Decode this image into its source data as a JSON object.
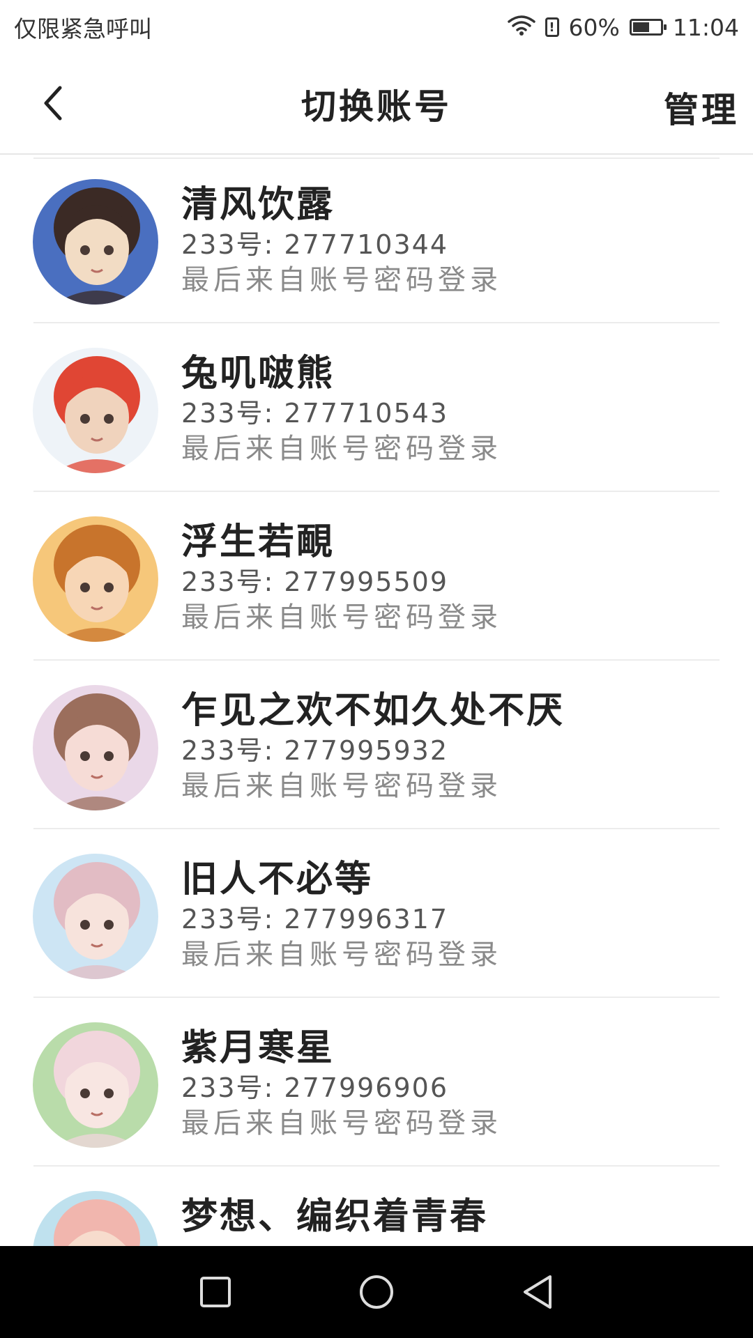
{
  "status_bar": {
    "carrier_text": "仅限紧急呼叫",
    "battery_percent": "60%",
    "battery_level": 0.6,
    "time": "11:04",
    "icons": [
      "wifi-icon",
      "alert-icon",
      "battery-icon"
    ]
  },
  "header": {
    "title": "切换账号",
    "manage_label": "管理",
    "back_icon": "chevron-left-icon"
  },
  "accounts": [
    {
      "nickname": "清风饮露",
      "uid_text": "233号: 277710344",
      "login_source": "最后来自账号密码登录",
      "avatar_palette": [
        "#4a6fc0",
        "#f2dcc4",
        "#3b2a25"
      ]
    },
    {
      "nickname": "兔叽啵熊",
      "uid_text": "233号: 277710543",
      "login_source": "最后来自账号密码登录",
      "avatar_palette": [
        "#eef3f8",
        "#f0d3bd",
        "#e04634"
      ]
    },
    {
      "nickname": "浮生若靦",
      "uid_text": "233号: 277995509",
      "login_source": "最后来自账号密码登录",
      "avatar_palette": [
        "#f6c77a",
        "#f7d6b6",
        "#c8742c"
      ]
    },
    {
      "nickname": "乍见之欢不如久处不厌",
      "uid_text": "233号: 277995932",
      "login_source": "最后来自账号密码登录",
      "avatar_palette": [
        "#ead8e8",
        "#f6dcd6",
        "#9b6e5c"
      ]
    },
    {
      "nickname": "旧人不必等",
      "uid_text": "233号: 277996317",
      "login_source": "最后来自账号密码登录",
      "avatar_palette": [
        "#cde5f4",
        "#f7e3dc",
        "#e2bcc4"
      ]
    },
    {
      "nickname": "紫月寒星",
      "uid_text": "233号: 277996906",
      "login_source": "最后来自账号密码登录",
      "avatar_palette": [
        "#b9dcaa",
        "#f8e6e2",
        "#f1d6dc"
      ]
    },
    {
      "nickname": "梦想、编织着青春",
      "uid_text": "",
      "login_source": "",
      "avatar_palette": [
        "#bfe1ee",
        "#f7dccd",
        "#f1b6ae"
      ]
    }
  ],
  "nav_bar": {
    "buttons": [
      "recent-apps-icon",
      "home-icon",
      "back-icon"
    ]
  }
}
